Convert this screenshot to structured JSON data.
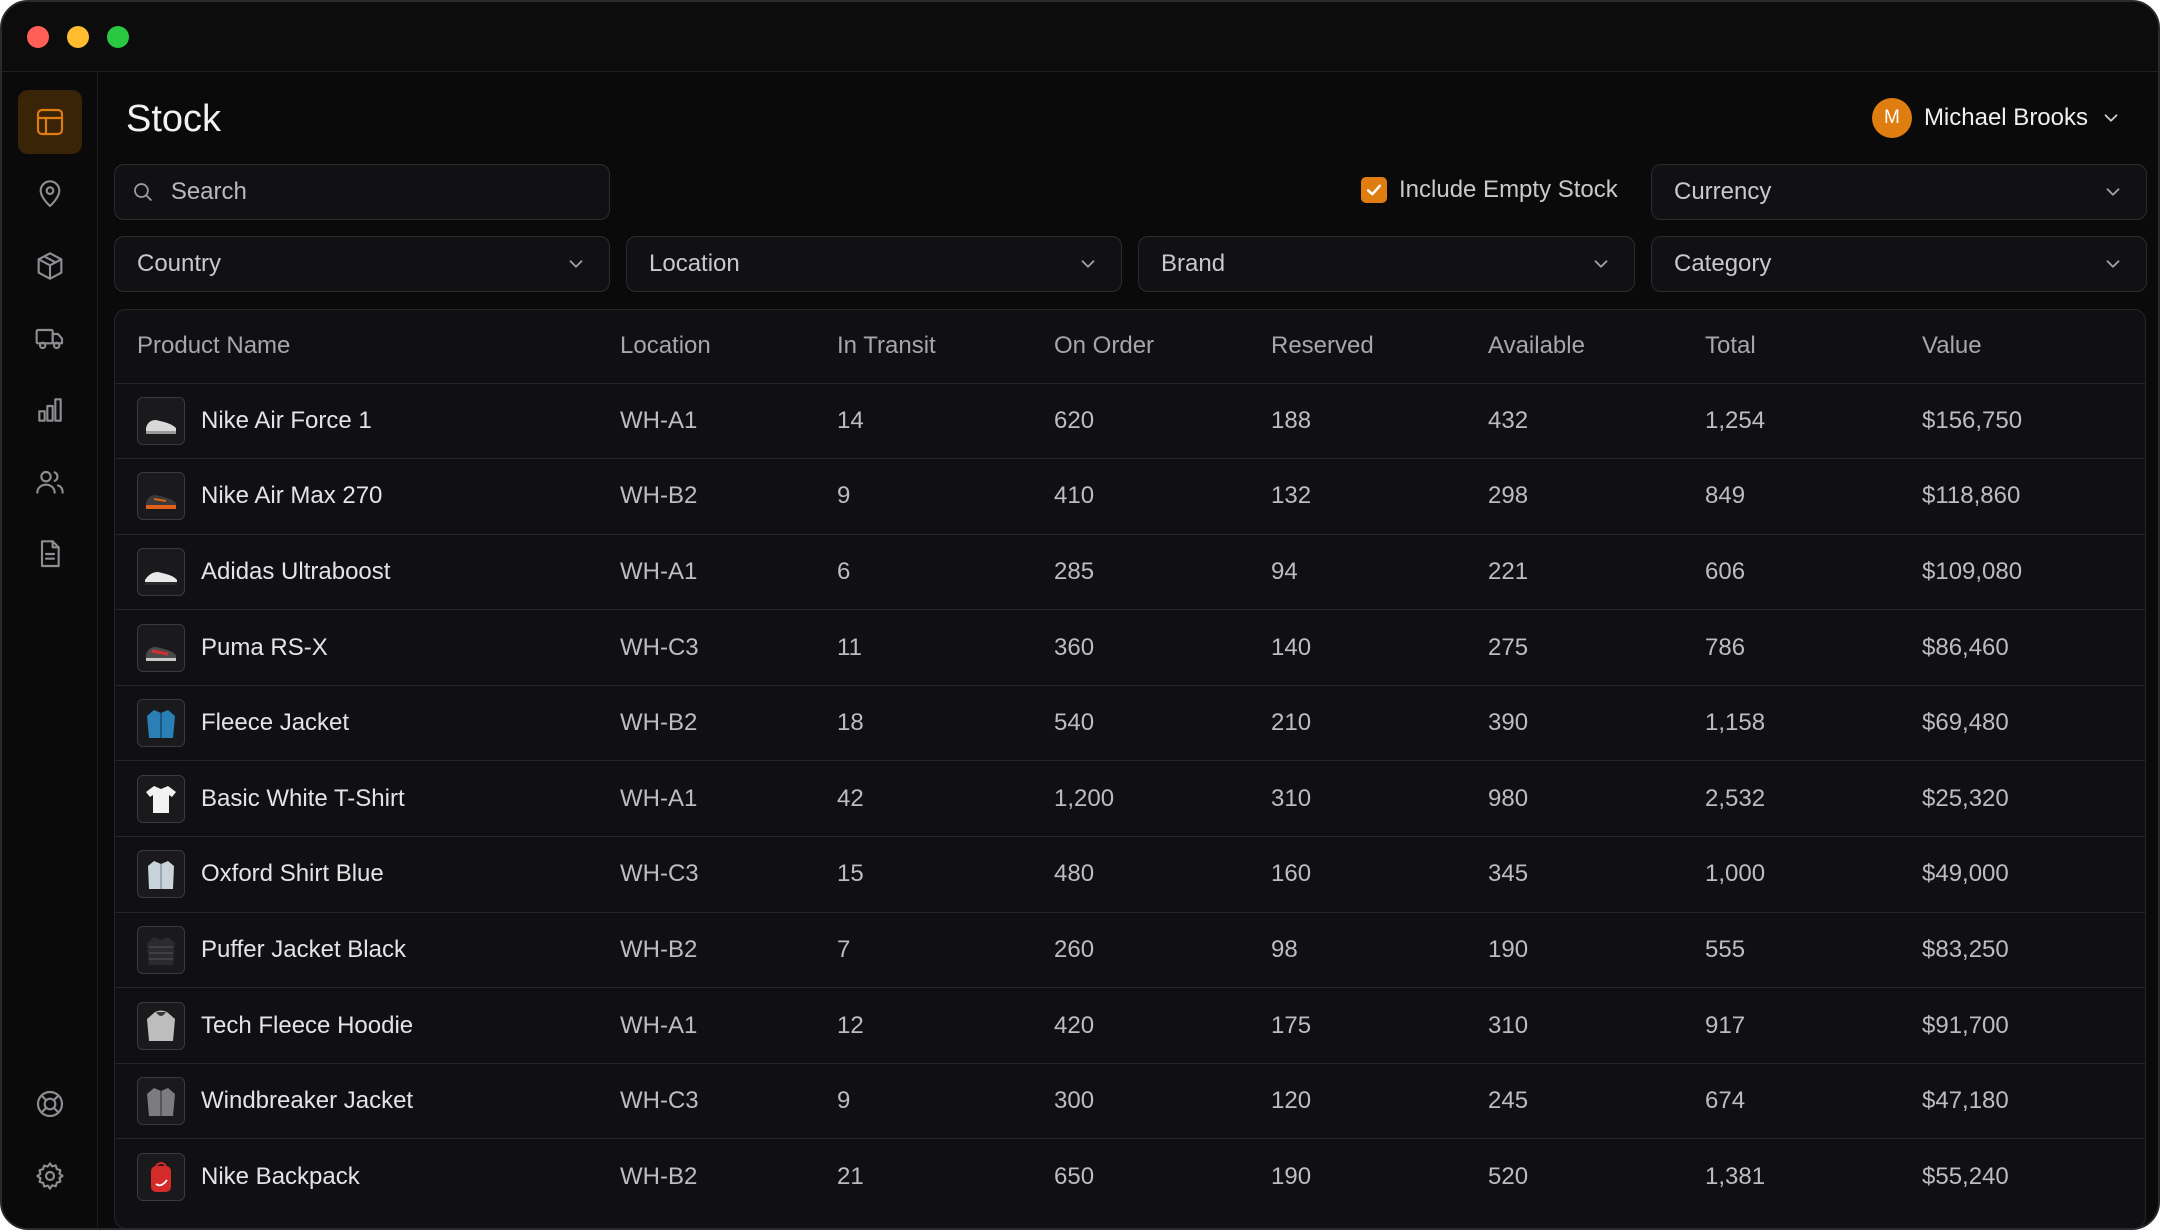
{
  "window": {
    "controls": [
      "close",
      "minimize",
      "zoom"
    ]
  },
  "sidebar": {
    "items": [
      {
        "icon": "layout-icon",
        "active": true
      },
      {
        "icon": "map-pin-icon",
        "active": false
      },
      {
        "icon": "box-icon",
        "active": false
      },
      {
        "icon": "truck-icon",
        "active": false
      },
      {
        "icon": "bar-chart-icon",
        "active": false
      },
      {
        "icon": "users-icon",
        "active": false
      },
      {
        "icon": "document-icon",
        "active": false
      }
    ],
    "bottom_items": [
      {
        "icon": "help-lifebuoy-icon"
      },
      {
        "icon": "gear-icon"
      }
    ],
    "accent_color": "#e07d10"
  },
  "header": {
    "title": "Stock",
    "user": {
      "initial": "M",
      "name": "Michael Brooks"
    }
  },
  "filters": {
    "search_placeholder": "Search",
    "include_empty_stock_label": "Include Empty Stock",
    "include_empty_stock_checked": true,
    "currency": "Currency",
    "country": "Country",
    "location": "Location",
    "brand": "Brand",
    "category": "Category"
  },
  "table": {
    "columns": [
      "Product Name",
      "Location",
      "In Transit",
      "On Order",
      "Reserved",
      "Available",
      "Total",
      "Value"
    ],
    "rows": [
      {
        "thumb": "sneaker-white",
        "name": "Nike Air Force 1",
        "location": "WH-A1",
        "in_transit": "14",
        "on_order": "620",
        "reserved": "188",
        "available": "432",
        "total": "1,254",
        "value": "$156,750"
      },
      {
        "thumb": "sneaker-orange",
        "name": "Nike Air Max 270",
        "location": "WH-B2",
        "in_transit": "9",
        "on_order": "410",
        "reserved": "132",
        "available": "298",
        "total": "849",
        "value": "$118,860"
      },
      {
        "thumb": "sneaker-black",
        "name": "Adidas Ultraboost",
        "location": "WH-A1",
        "in_transit": "6",
        "on_order": "285",
        "reserved": "94",
        "available": "221",
        "total": "606",
        "value": "$109,080"
      },
      {
        "thumb": "sneaker-red",
        "name": "Puma RS-X",
        "location": "WH-C3",
        "in_transit": "11",
        "on_order": "360",
        "reserved": "140",
        "available": "275",
        "total": "786",
        "value": "$86,460"
      },
      {
        "thumb": "jacket-blue",
        "name": "Fleece Jacket",
        "location": "WH-B2",
        "in_transit": "18",
        "on_order": "540",
        "reserved": "210",
        "available": "390",
        "total": "1,158",
        "value": "$69,480"
      },
      {
        "thumb": "tshirt-white",
        "name": "Basic White T-Shirt",
        "location": "WH-A1",
        "in_transit": "42",
        "on_order": "1,200",
        "reserved": "310",
        "available": "980",
        "total": "2,532",
        "value": "$25,320"
      },
      {
        "thumb": "shirt-light",
        "name": "Oxford Shirt Blue",
        "location": "WH-C3",
        "in_transit": "15",
        "on_order": "480",
        "reserved": "160",
        "available": "345",
        "total": "1,000",
        "value": "$49,000"
      },
      {
        "thumb": "jacket-black",
        "name": "Puffer Jacket Black",
        "location": "WH-B2",
        "in_transit": "7",
        "on_order": "260",
        "reserved": "98",
        "available": "190",
        "total": "555",
        "value": "$83,250"
      },
      {
        "thumb": "hoodie-gray",
        "name": "Tech Fleece Hoodie",
        "location": "WH-A1",
        "in_transit": "12",
        "on_order": "420",
        "reserved": "175",
        "available": "310",
        "total": "917",
        "value": "$91,700"
      },
      {
        "thumb": "jacket-gray",
        "name": "Windbreaker Jacket",
        "location": "WH-C3",
        "in_transit": "9",
        "on_order": "300",
        "reserved": "120",
        "available": "245",
        "total": "674",
        "value": "$47,180"
      },
      {
        "thumb": "backpack-red",
        "name": "Nike Backpack",
        "location": "WH-B2",
        "in_transit": "21",
        "on_order": "650",
        "reserved": "190",
        "available": "520",
        "total": "1,381",
        "value": "$55,240"
      }
    ]
  }
}
